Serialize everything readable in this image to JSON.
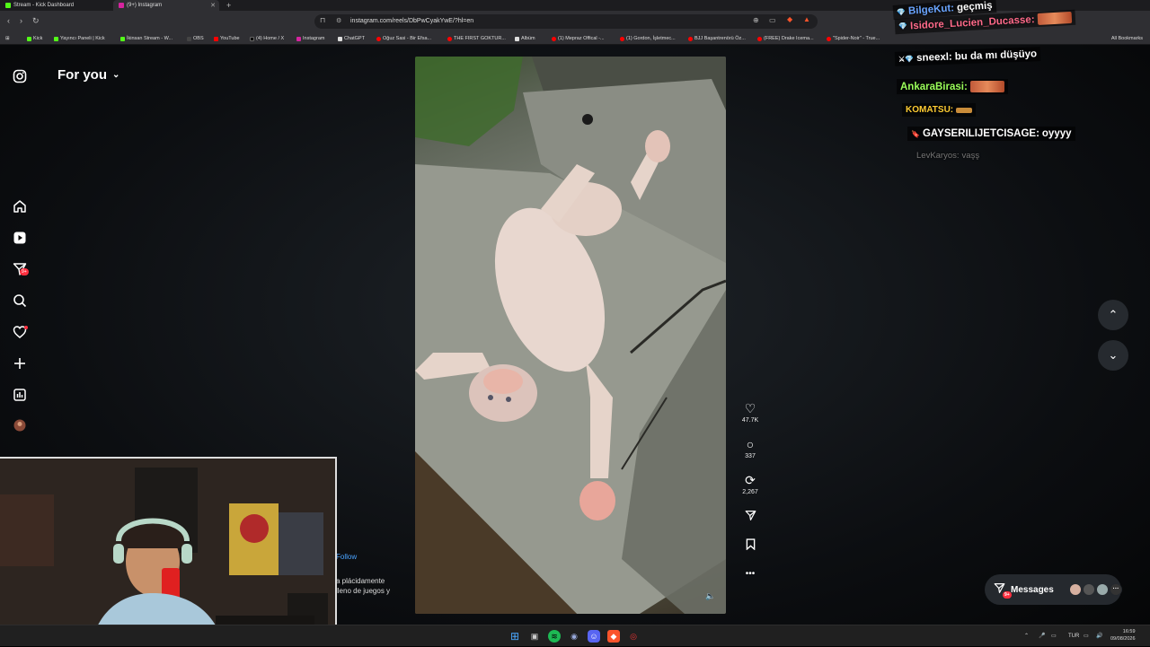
{
  "browser": {
    "tabs": [
      {
        "title": "Stream - Kick Dashboard",
        "color": "#53fc18"
      },
      {
        "title": "(9+) Instagram",
        "color": "#d6249f"
      }
    ],
    "new_tab": "+",
    "url": "instagram.com/reels/DbPwCyakYwE/?hl=en",
    "bookmarks": [
      {
        "label": "Kick",
        "color": "#53fc18"
      },
      {
        "label": "Yayıncı Paneli | Kick",
        "color": "#53fc18"
      },
      {
        "label": "İkinsan Stream - W...",
        "color": "#53fc18"
      },
      {
        "label": "OBS",
        "color": "#444"
      },
      {
        "label": "YouTube",
        "color": "#ff0000"
      },
      {
        "label": "(4) Home / X",
        "color": "#000"
      },
      {
        "label": "Instagram",
        "color": "#d6249f"
      },
      {
        "label": "ChatGPT",
        "color": "#ddd"
      },
      {
        "label": "Oğuz Sasi - Bir Efsa...",
        "color": "#ff0000"
      },
      {
        "label": "THE FIRST GOKTUR...",
        "color": "#ff0000"
      },
      {
        "label": "Albüm",
        "color": "#ddd"
      },
      {
        "label": "(1) Mepraz Offical -...",
        "color": "#ff0000"
      },
      {
        "label": "(1) Gordon, İşletmec...",
        "color": "#ff0000"
      },
      {
        "label": "BJJ Başantrenörü Öz...",
        "color": "#ff0000"
      },
      {
        "label": "(FREE) Drake Icema...",
        "color": "#ff0000"
      },
      {
        "label": "\"Spider-Noir\" - True...",
        "color": "#ff0000"
      }
    ],
    "all_bookmarks": "All Bookmarks"
  },
  "instagram": {
    "feed_title": "For you",
    "notification_badge": "9+",
    "reel": {
      "likes": "47.7K",
      "comments": "337",
      "reposts": "2,267"
    },
    "follow_label": "Follow",
    "caption_line1": "a plácidamente",
    "caption_line2": "lleno de juegos y",
    "messages_label": "Messages",
    "messages_badge": "9+"
  },
  "chat": [
    {
      "user": "BilgeKut:",
      "message": "geçmiş",
      "color": "#6aa5ff",
      "emote": false
    },
    {
      "user": "Isidore_Lucien_Ducasse:",
      "message": "",
      "color": "#ff6a8a",
      "emote": true
    },
    {
      "user": "sneexl:",
      "message": "bu da mı düşüyo",
      "color": "#ffffff",
      "emote": false
    },
    {
      "user": "AnkaraBirasi:",
      "message": "",
      "color": "#9bff5a",
      "emote": true
    },
    {
      "user": "KOMATSU:",
      "message": "",
      "color": "#ffcc33",
      "emote": "small"
    },
    {
      "user": "GAYSERILIJETCISAGE:",
      "message": "oyyyy",
      "color": "#ffffff",
      "emote": false
    },
    {
      "user": "LevKaryos:",
      "message": "vaşş",
      "color": "#777777",
      "emote": false
    }
  ],
  "taskbar": {
    "lang": "TUR",
    "time": "16:59",
    "date": "09/08/2026"
  }
}
